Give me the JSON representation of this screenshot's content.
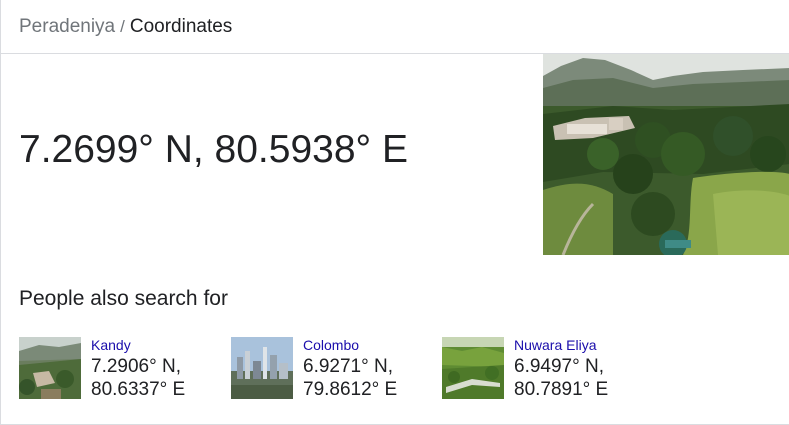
{
  "breadcrumb": {
    "parent": "Peradeniya",
    "separator": "/",
    "current": "Coordinates"
  },
  "result": {
    "coordinates": "7.2699° N, 80.5938° E"
  },
  "people_also_search": {
    "title": "People also search for",
    "items": [
      {
        "name": "Kandy",
        "lat": "7.2906° N,",
        "lon": "80.6337° E"
      },
      {
        "name": "Colombo",
        "lat": "6.9271° N,",
        "lon": "79.8612° E"
      },
      {
        "name": "Nuwara Eliya",
        "lat": "6.9497° N,",
        "lon": "80.7891° E"
      }
    ]
  },
  "colors": {
    "link": "#1a0dab",
    "breadcrumb_parent": "#70757a",
    "text": "#202124",
    "divider": "#dadce0"
  }
}
